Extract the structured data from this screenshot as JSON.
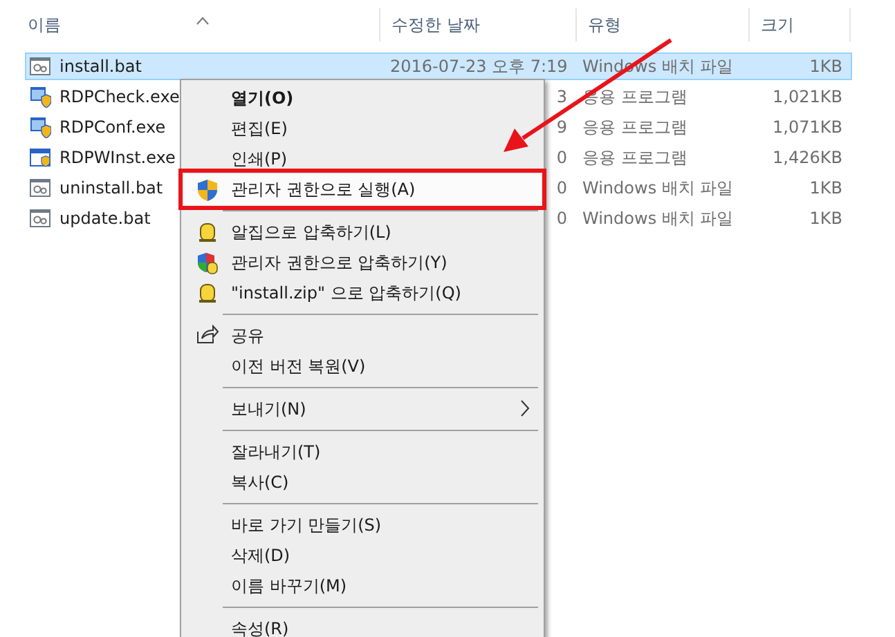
{
  "columns": [
    {
      "label": "이름",
      "sorted": true
    },
    {
      "label": "수정한 날짜",
      "sorted": false
    },
    {
      "label": "유형",
      "sorted": false
    },
    {
      "label": "크기",
      "sorted": false
    }
  ],
  "files": [
    {
      "name": "install.bat",
      "kind": "bat",
      "date": "2016-07-23 오후 7:19",
      "type": "Windows 배치 파일",
      "size": "1KB",
      "selected": true
    },
    {
      "name": "RDPCheck.exe",
      "kind": "exe",
      "date": "3",
      "type": "응용 프로그램",
      "size": "1,021KB",
      "selected": false
    },
    {
      "name": "RDPConf.exe",
      "kind": "exe",
      "date": "9",
      "type": "응용 프로그램",
      "size": "1,071KB",
      "selected": false
    },
    {
      "name": "RDPWInst.exe",
      "kind": "installer",
      "date": "0",
      "type": "응용 프로그램",
      "size": "1,426KB",
      "selected": false
    },
    {
      "name": "uninstall.bat",
      "kind": "bat",
      "date": "0",
      "type": "Windows 배치 파일",
      "size": "1KB",
      "selected": false
    },
    {
      "name": "update.bat",
      "kind": "bat",
      "date": "0",
      "type": "Windows 배치 파일",
      "size": "1KB",
      "selected": false
    }
  ],
  "context_menu": {
    "items": [
      {
        "kind": "item",
        "label": "열기(O)",
        "default": true
      },
      {
        "kind": "item",
        "label": "편집(E)"
      },
      {
        "kind": "item",
        "label": "인쇄(P)"
      },
      {
        "kind": "shield",
        "label": "관리자 권한으로 실행(A)",
        "highlighted": true
      },
      {
        "kind": "separator"
      },
      {
        "kind": "zip",
        "label": "알집으로 압축하기(L)"
      },
      {
        "kind": "shield-zip",
        "label": "관리자 권한으로 압축하기(Y)"
      },
      {
        "kind": "zip",
        "label": "\"install.zip\" 으로 압축하기(Q)"
      },
      {
        "kind": "separator"
      },
      {
        "kind": "share",
        "label": "공유"
      },
      {
        "kind": "item",
        "label": "이전 버전 복원(V)"
      },
      {
        "kind": "separator"
      },
      {
        "kind": "item",
        "label": "보내기(N)",
        "submenu": true
      },
      {
        "kind": "separator"
      },
      {
        "kind": "item",
        "label": "잘라내기(T)"
      },
      {
        "kind": "item",
        "label": "복사(C)"
      },
      {
        "kind": "separator"
      },
      {
        "kind": "item",
        "label": "바로 가기 만들기(S)"
      },
      {
        "kind": "item",
        "label": "삭제(D)"
      },
      {
        "kind": "item",
        "label": "이름 바꾸기(M)"
      },
      {
        "kind": "separator"
      },
      {
        "kind": "item",
        "label": "속성(R)"
      }
    ]
  }
}
